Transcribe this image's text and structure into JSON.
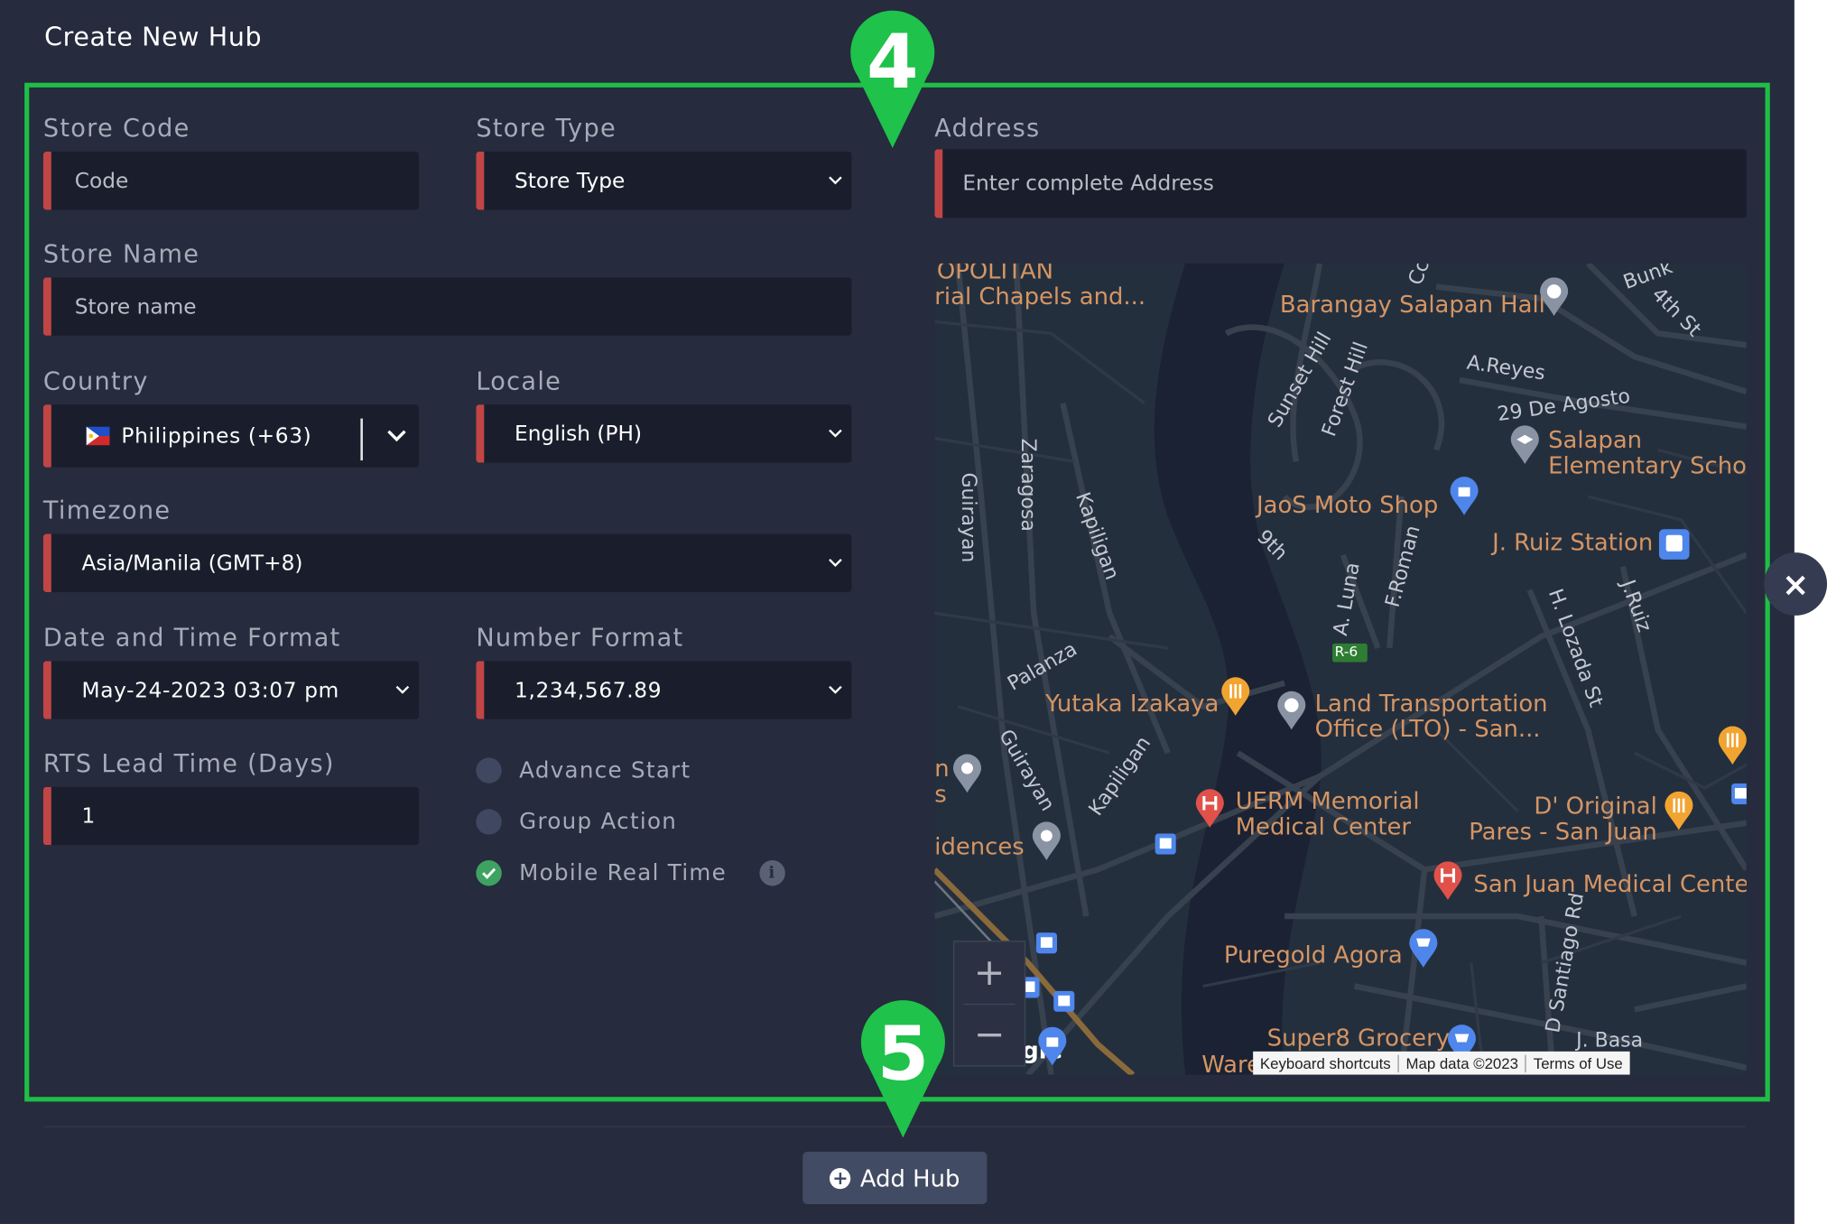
{
  "modal": {
    "title": "Create New Hub"
  },
  "form": {
    "store_code": {
      "label": "Store Code",
      "placeholder": "Code"
    },
    "store_type": {
      "label": "Store Type",
      "value": "Store Type"
    },
    "address": {
      "label": "Address",
      "placeholder": "Enter complete Address"
    },
    "store_name": {
      "label": "Store Name",
      "placeholder": "Store name"
    },
    "country": {
      "label": "Country",
      "value": "Philippines (+63)"
    },
    "locale": {
      "label": "Locale",
      "value": "English (PH)"
    },
    "timezone": {
      "label": "Timezone",
      "value": "Asia/Manila (GMT+8)"
    },
    "date_time_format": {
      "label": "Date and Time Format",
      "value": "May-24-2023 03:07 pm"
    },
    "number_format": {
      "label": "Number Format",
      "value": "1,234,567.89"
    },
    "rts_lead_time": {
      "label": "RTS Lead Time (Days)",
      "value": "1"
    },
    "options": [
      {
        "label": "Advance Start",
        "checked": false
      },
      {
        "label": "Group Action",
        "checked": false
      },
      {
        "label": "Mobile Real Time",
        "checked": true
      }
    ]
  },
  "map": {
    "places": {
      "metropolitan": "OPOLITAN",
      "chapels": "rial Chapels and...",
      "barangay_hall": "Barangay Salapan Hall",
      "bunk": "Bunk",
      "fourth_st": "4th St",
      "cc": "Cc",
      "areyes": "A.Reyes",
      "de_agosto": "29 De Agosto",
      "salapan_school": "Salapan\nElementary Schoo",
      "jaos": "JaoS Moto Shop",
      "jruiz_station": "J. Ruiz Station",
      "yutaka": "Yutaka Izakaya",
      "lto": "Land Transportation\nOffice (LTO) - San...",
      "uerm": "UERM Memorial\nMedical Center",
      "d_original": "D' Original\nPares - San Juan",
      "sanjuan_medical": "San Juan Medical Cente",
      "puregold": "Puregold Agora",
      "super8": "Super8 Grocery",
      "ware": "Ware",
      "idences": "idences",
      "n_s": "n\ns",
      "gle": "gle"
    },
    "streets": {
      "sunset_hill": "Sunset Hill",
      "forest_hill": "Forest Hill",
      "guirayan": "Guirayan",
      "zaragosa": "Zaragosa",
      "kapiligan": "Kapiligan",
      "ninth": "9th",
      "a_luna": "A. Luna",
      "f_roman": "F.Roman",
      "r6": "R-6",
      "h_lozada": "H. Lozada St",
      "j_ruiz": "J.Ruiz",
      "palanza": "Palanza",
      "guirayan2": "Guirayan",
      "kapiligan2": "Kapiligan",
      "santiago": "D Santiago Rd",
      "j_basa": "J. Basa"
    },
    "zoom_in": "+",
    "zoom_out": "−",
    "attribution": {
      "shortcuts": "Keyboard shortcuts",
      "data": "Map data ©2023",
      "terms": "Terms of Use"
    }
  },
  "markers": {
    "step4": "4",
    "step5": "5"
  },
  "actions": {
    "add_hub": "Add Hub",
    "close": "×"
  }
}
